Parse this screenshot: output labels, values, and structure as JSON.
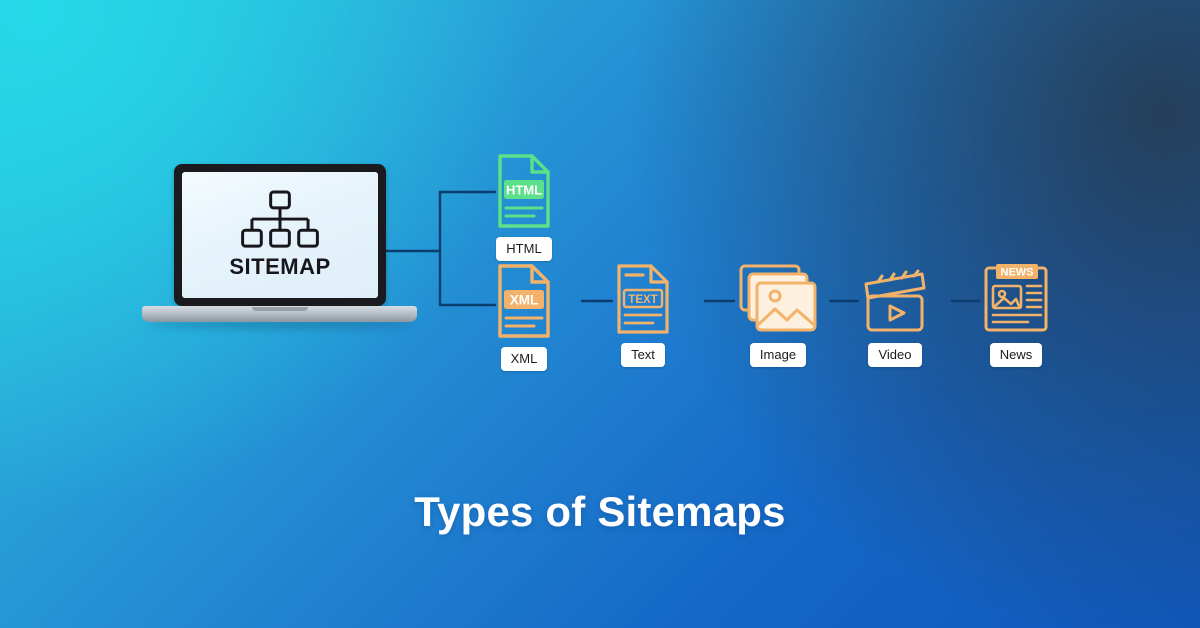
{
  "theme": {
    "bg_gradient_from": "#2bc9e0",
    "bg_gradient_to": "#0f57bb",
    "accent_orange": "#f3b26a",
    "accent_green": "#5ce08a",
    "chip_bg": "#ffffff",
    "line_color": "#0d3c6e",
    "title_color": "#ffffff"
  },
  "laptop": {
    "screen_label": "SITEMAP",
    "screen_icon": "hierarchy-tree-icon"
  },
  "diagram": {
    "title": "Types of Sitemaps",
    "nodes": [
      {
        "id": "html",
        "label": "HTML",
        "icon": "file-html-icon",
        "badge": "HTML",
        "color": "#5ce08a"
      },
      {
        "id": "xml",
        "label": "XML",
        "icon": "file-xml-icon",
        "badge": "XML",
        "color": "#f3b26a"
      },
      {
        "id": "text",
        "label": "Text",
        "icon": "file-text-icon",
        "badge": "TEXT",
        "color": "#f3b26a"
      },
      {
        "id": "image",
        "label": "Image",
        "icon": "image-stack-icon",
        "badge": "",
        "color": "#f3b26a"
      },
      {
        "id": "video",
        "label": "Video",
        "icon": "clapperboard-play-icon",
        "badge": "",
        "color": "#f3b26a"
      },
      {
        "id": "news",
        "label": "News",
        "icon": "newspaper-icon",
        "badge": "NEWS",
        "color": "#f3b26a"
      }
    ]
  }
}
